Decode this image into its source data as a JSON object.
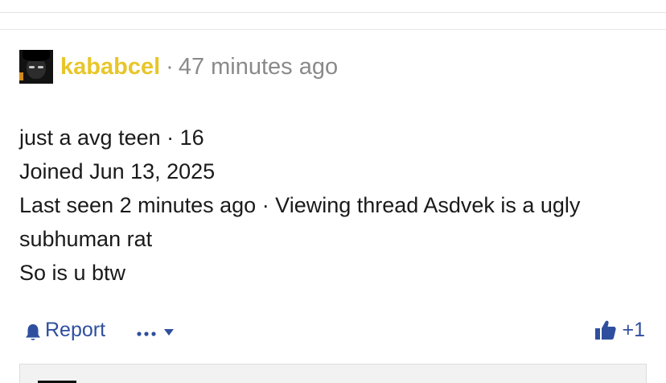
{
  "post": {
    "author": {
      "username": "kababcel",
      "avatar_icon": "anime-avatar-icon"
    },
    "meta_separator": "·",
    "timestamp": "47 minutes ago",
    "body_lines": [
      "just a avg teen · 16",
      "Joined Jun 13, 2025",
      "Last seen 2 minutes ago · Viewing thread Asdvek is a ugly",
      "subhuman rat",
      "So is u btw"
    ]
  },
  "actions": {
    "report_label": "Report",
    "report_icon": "bell-icon",
    "more_icon": "ellipsis-icon",
    "more_caret_icon": "chevron-down-icon",
    "reaction_icon": "thumbs-up-icon",
    "reaction_count": "+1"
  },
  "colors": {
    "username": "#e8c62a",
    "meta_text": "#8a8a8a",
    "body_text": "#1a1a1a",
    "action_link": "#2f4f9e",
    "divider": "#e6e6e6"
  }
}
